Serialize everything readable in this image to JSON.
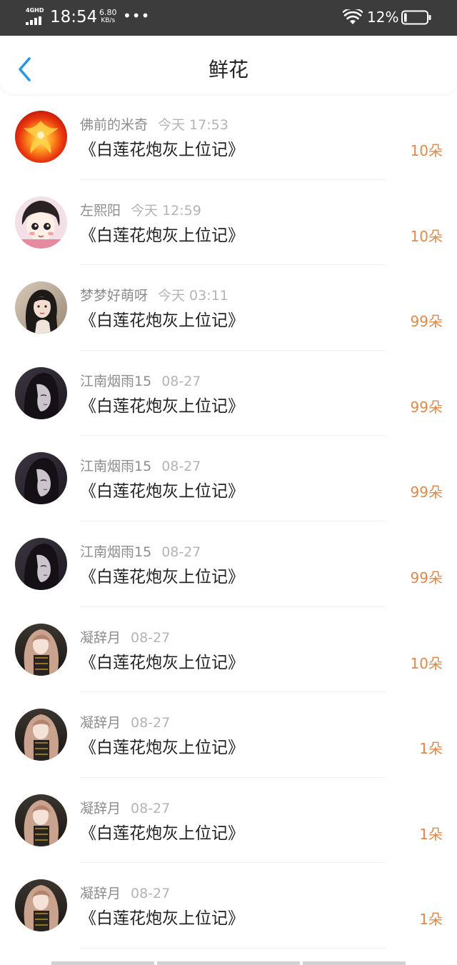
{
  "status_bar": {
    "network": "4GHD",
    "time": "18:54",
    "speed_value": "6.80",
    "speed_unit": "KB/s",
    "dots": "•••",
    "battery_pct": "12%",
    "battery_level": 0.12
  },
  "header": {
    "title": "鲜花"
  },
  "colors": {
    "amount": "#e0894a",
    "accent_back": "#2a96e8"
  },
  "items": [
    {
      "user": "佛前的米奇",
      "time": "今天 17:53",
      "book": "《白莲花炮灰上位记》",
      "amount": "10朵",
      "avatar": "phoenix-avatar"
    },
    {
      "user": "左熙阳",
      "time": "今天 12:59",
      "book": "《白莲花炮灰上位记》",
      "amount": "10朵",
      "avatar": "cartoon-girl-avatar"
    },
    {
      "user": "梦梦好萌呀",
      "time": "今天 03:11",
      "book": "《白莲花炮灰上位记》",
      "amount": "99朵",
      "avatar": "girl-photo-avatar"
    },
    {
      "user": "江南烟雨15",
      "time": "08-27",
      "book": "《白莲花炮灰上位记》",
      "amount": "99朵",
      "avatar": "ink-woman-avatar"
    },
    {
      "user": "江南烟雨15",
      "time": "08-27",
      "book": "《白莲花炮灰上位记》",
      "amount": "99朵",
      "avatar": "ink-woman-avatar"
    },
    {
      "user": "江南烟雨15",
      "time": "08-27",
      "book": "《白莲花炮灰上位记》",
      "amount": "99朵",
      "avatar": "ink-woman-avatar"
    },
    {
      "user": "凝辞月",
      "time": "08-27",
      "book": "《白莲花炮灰上位记》",
      "amount": "10朵",
      "avatar": "anime-girl-avatar"
    },
    {
      "user": "凝辞月",
      "time": "08-27",
      "book": "《白莲花炮灰上位记》",
      "amount": "1朵",
      "avatar": "anime-girl-avatar"
    },
    {
      "user": "凝辞月",
      "time": "08-27",
      "book": "《白莲花炮灰上位记》",
      "amount": "1朵",
      "avatar": "anime-girl-avatar"
    },
    {
      "user": "凝辞月",
      "time": "08-27",
      "book": "《白莲花炮灰上位记》",
      "amount": "1朵",
      "avatar": "anime-girl-avatar"
    }
  ]
}
